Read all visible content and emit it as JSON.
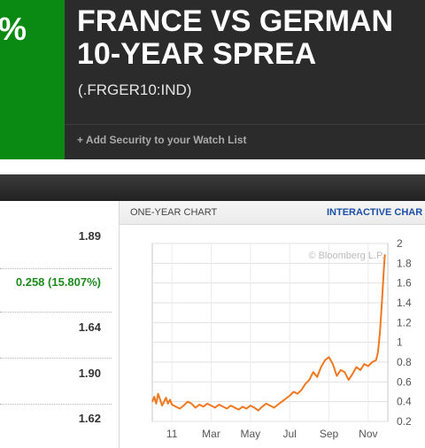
{
  "header": {
    "change_percent": "%",
    "title_line1": "FRANCE VS GERMAN",
    "title_line2": "10-YEAR SPREA",
    "ticker": "(.FRGER10:IND)",
    "watch_list_label": "+ Add Security to your Watch List"
  },
  "stats": {
    "values": [
      "1.89",
      "0.258 (15.807%)",
      "1.64",
      "1.90",
      "1.62"
    ]
  },
  "chart_panel": {
    "label": "ONE-YEAR CHART",
    "interactive_link": "INTERACTIVE CHAR"
  },
  "colors": {
    "header_bg": "#2b2b2b",
    "change_positive": "#0a8a12",
    "line": "#f07820",
    "link": "#1c4fa8"
  },
  "chart_data": {
    "type": "line",
    "watermark": "© Bloomberg L.P.",
    "categories": [
      "11",
      "Mar",
      "May",
      "Jul",
      "Sep",
      "Nov"
    ],
    "ylim": [
      0.2,
      2.0
    ],
    "yticks": [
      2,
      1.8,
      1.6,
      1.4,
      1.2,
      1,
      0.8,
      0.6,
      0.4,
      0.2
    ],
    "ytick_labels": [
      "2",
      "1.8",
      "1.6",
      "1.4",
      "1.2",
      "1",
      "0.8",
      "0.6",
      "0.4",
      "0.2"
    ],
    "grid": true,
    "series": [
      {
        "x": [
          0,
          0.1,
          0.2,
          0.3,
          0.4,
          0.5,
          0.6,
          0.7,
          0.8,
          0.9,
          1.0,
          1.2,
          1.4,
          1.6,
          1.8,
          2.0,
          2.2,
          2.4,
          2.6,
          2.8,
          3.0,
          3.2,
          3.4,
          3.6,
          3.8,
          4.0,
          4.2,
          4.4,
          4.6,
          4.8,
          5.0,
          5.2,
          5.4,
          5.6,
          5.8,
          6.0,
          6.2,
          6.4,
          6.6,
          6.8,
          7.0,
          7.2,
          7.4,
          7.6,
          7.8,
          8.0,
          8.2,
          8.4,
          8.6,
          8.8,
          9.0,
          9.2,
          9.4,
          9.6,
          9.8,
          10.0,
          10.2,
          10.4,
          10.6,
          10.8,
          11.0,
          11.2,
          11.4,
          11.5,
          11.6,
          11.7,
          11.8,
          11.85
        ],
        "values": [
          0.4,
          0.45,
          0.38,
          0.48,
          0.42,
          0.36,
          0.4,
          0.44,
          0.38,
          0.42,
          0.37,
          0.35,
          0.33,
          0.36,
          0.4,
          0.38,
          0.34,
          0.37,
          0.35,
          0.38,
          0.36,
          0.34,
          0.37,
          0.35,
          0.33,
          0.36,
          0.34,
          0.32,
          0.35,
          0.33,
          0.36,
          0.34,
          0.31,
          0.35,
          0.38,
          0.36,
          0.34,
          0.37,
          0.4,
          0.43,
          0.46,
          0.5,
          0.48,
          0.52,
          0.58,
          0.62,
          0.7,
          0.65,
          0.75,
          0.82,
          0.85,
          0.78,
          0.66,
          0.72,
          0.7,
          0.62,
          0.68,
          0.75,
          0.72,
          0.78,
          0.76,
          0.8,
          0.82,
          0.9,
          1.1,
          1.4,
          1.75,
          1.89
        ]
      }
    ]
  }
}
